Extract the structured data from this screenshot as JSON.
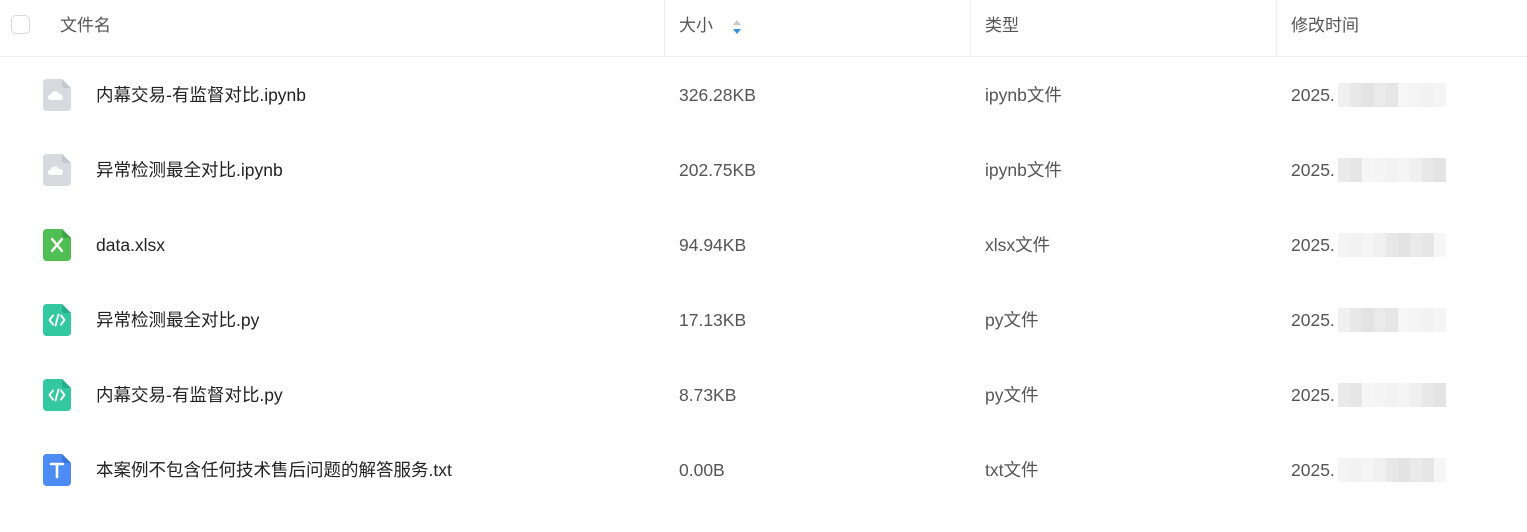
{
  "columns": {
    "name": "文件名",
    "size": "大小",
    "type": "类型",
    "modified": "修改时间"
  },
  "icons": {
    "checkbox": "checkbox-icon",
    "sort": "sort-icon",
    "ipynb": "cloud-file-icon",
    "xlsx": "excel-file-icon",
    "py": "code-file-icon",
    "txt": "text-file-icon"
  },
  "colors": {
    "ipynb": "#d7dbe0",
    "xlsx": "#4fbf53",
    "py": "#34c8a0",
    "txt": "#4d8cf5",
    "sort_up": "#c8c8c8",
    "sort_down": "#3a8ee6"
  },
  "files": [
    {
      "name": "内幕交易-有监督对比.ipynb",
      "size": "326.28KB",
      "type": "ipynb文件",
      "modified": "2025.",
      "kind": "ipynb"
    },
    {
      "name": "异常检测最全对比.ipynb",
      "size": "202.75KB",
      "type": "ipynb文件",
      "modified": "2025.",
      "kind": "ipynb"
    },
    {
      "name": "data.xlsx",
      "size": "94.94KB",
      "type": "xlsx文件",
      "modified": "2025.",
      "kind": "xlsx"
    },
    {
      "name": "异常检测最全对比.py",
      "size": "17.13KB",
      "type": "py文件",
      "modified": "2025.",
      "kind": "py"
    },
    {
      "name": "内幕交易-有监督对比.py",
      "size": "8.73KB",
      "type": "py文件",
      "modified": "2025.",
      "kind": "py"
    },
    {
      "name": "本案例不包含任何技术售后问题的解答服务.txt",
      "size": "0.00B",
      "type": "txt文件",
      "modified": "2025.",
      "kind": "txt"
    }
  ]
}
